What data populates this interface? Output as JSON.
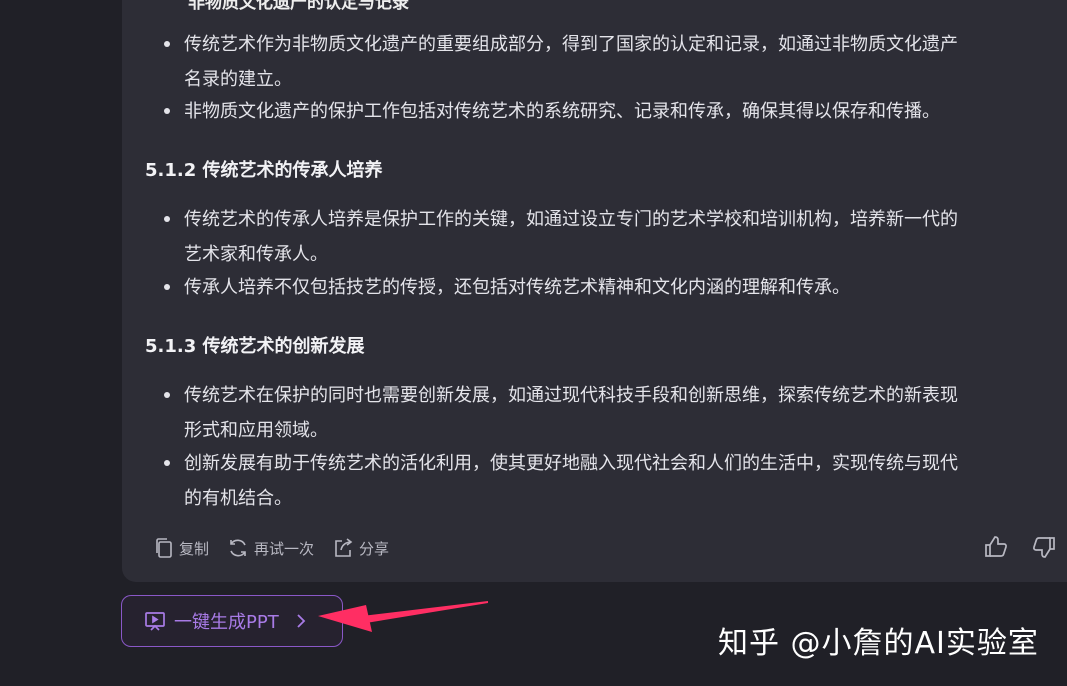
{
  "partial_heading": "非物质文化遗产的认定与记录",
  "sections": [
    {
      "heading": "",
      "bullets": [
        [
          "传统艺术作为非物质文化遗产的重要组成部分，得到了国家的认定和记录，如通过非物质文化遗产",
          "名录的建立。"
        ],
        [
          "非物质文化遗产的保护工作包括对传统艺术的系统研究、记录和传承，确保其得以保存和传播。"
        ]
      ]
    },
    {
      "heading": "5.1.2 传统艺术的传承人培养",
      "bullets": [
        [
          "传统艺术的传承人培养是保护工作的关键，如通过设立专门的艺术学校和培训机构，培养新一代的",
          "艺术家和传承人。"
        ],
        [
          "传承人培养不仅包括技艺的传授，还包括对传统艺术精神和文化内涵的理解和传承。"
        ]
      ]
    },
    {
      "heading": "5.1.3 传统艺术的创新发展",
      "bullets": [
        [
          "传统艺术在保护的同时也需要创新发展，如通过现代科技手段和创新思维，探索传统艺术的新表现",
          "形式和应用领域。"
        ],
        [
          "创新发展有助于传统艺术的活化利用，使其更好地融入现代社会和人们的生活中，实现传统与现代",
          "的有机结合。"
        ]
      ]
    }
  ],
  "actions": {
    "copy_label": "复制",
    "retry_label": "再试一次",
    "share_label": "分享"
  },
  "ppt_button": {
    "label": "一键生成PPT"
  },
  "watermark": "知乎 @小詹的AI实验室",
  "icons": {
    "copy": "copy-icon",
    "retry": "refresh-icon",
    "share": "share-icon",
    "thumbs_up": "thumbs-up-icon",
    "thumbs_down": "thumbs-down-icon",
    "ppt": "presentation-icon",
    "chevron": "chevron-right-icon"
  },
  "colors": {
    "background": "#202027",
    "card": "#2d2d36",
    "text": "#e4e4ea",
    "accent": "#a87be6",
    "arrow": "#ff2e63"
  }
}
